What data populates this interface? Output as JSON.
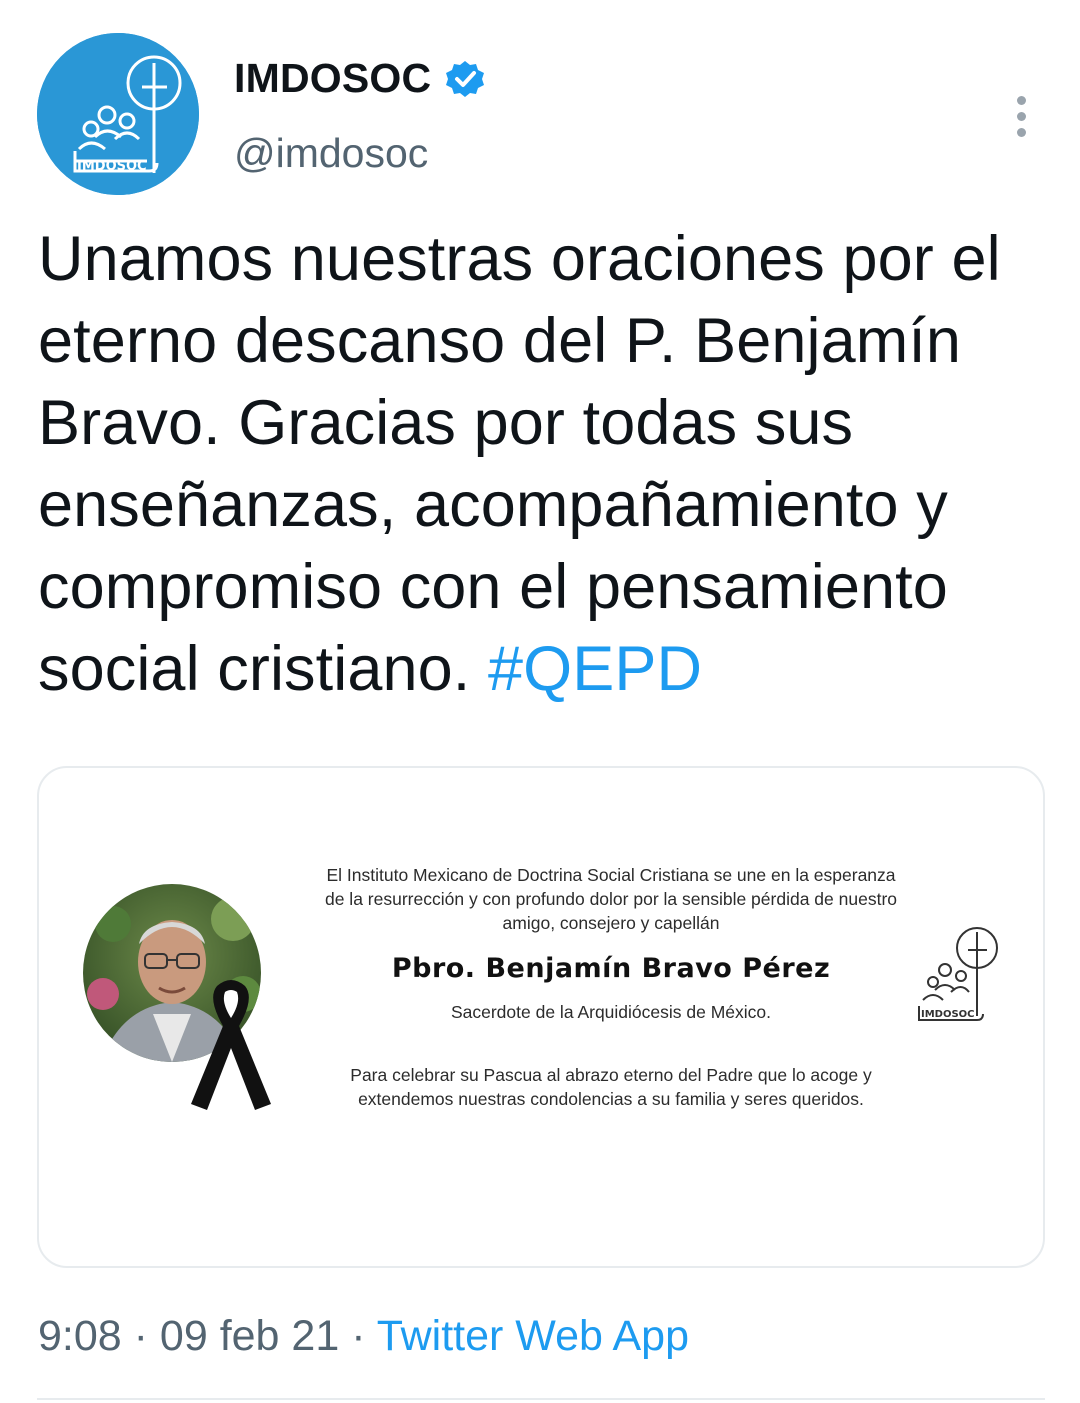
{
  "tweet": {
    "display_name": "IMDOSOC",
    "handle": "@imdosoc",
    "avatar_logo_text": "IMDOSOC",
    "text_lines": [
      "Unamos nuestras oraciones por el",
      "eterno descanso del P. Benjamín",
      "Bravo. Gracias por todas sus",
      "enseñanzas, acompañamiento y",
      "compromiso con el pensamiento",
      "social cristiano. "
    ],
    "hashtag": "#QEPD"
  },
  "media": {
    "intro_lines": [
      "El Instituto Mexicano de Doctrina Social Cristiana se une en la esperanza",
      "de la resurrección y con profundo dolor por la sensible pérdida de nuestro",
      "amigo, consejero y capellán"
    ],
    "name": "Pbro. Benjamín Bravo Pérez",
    "title": "Sacerdote de la Arquidiócesis de México.",
    "closing_lines": [
      "Para celebrar su Pascua al abrazo eterno del Padre que lo acoge y",
      "extendemos nuestras condolencias a su familia y seres queridos."
    ],
    "logo_text": "IMDOSOC"
  },
  "footer": {
    "time": "9:08",
    "separator": " · ",
    "date": "09 feb 21",
    "source": "Twitter Web App"
  },
  "colors": {
    "brand_blue": "#2a97d6",
    "link_blue": "#1d9bf0",
    "muted_gray": "#536471"
  },
  "icons": [
    "verified-badge-icon",
    "more-options-icon",
    "mourning-ribbon-icon"
  ]
}
